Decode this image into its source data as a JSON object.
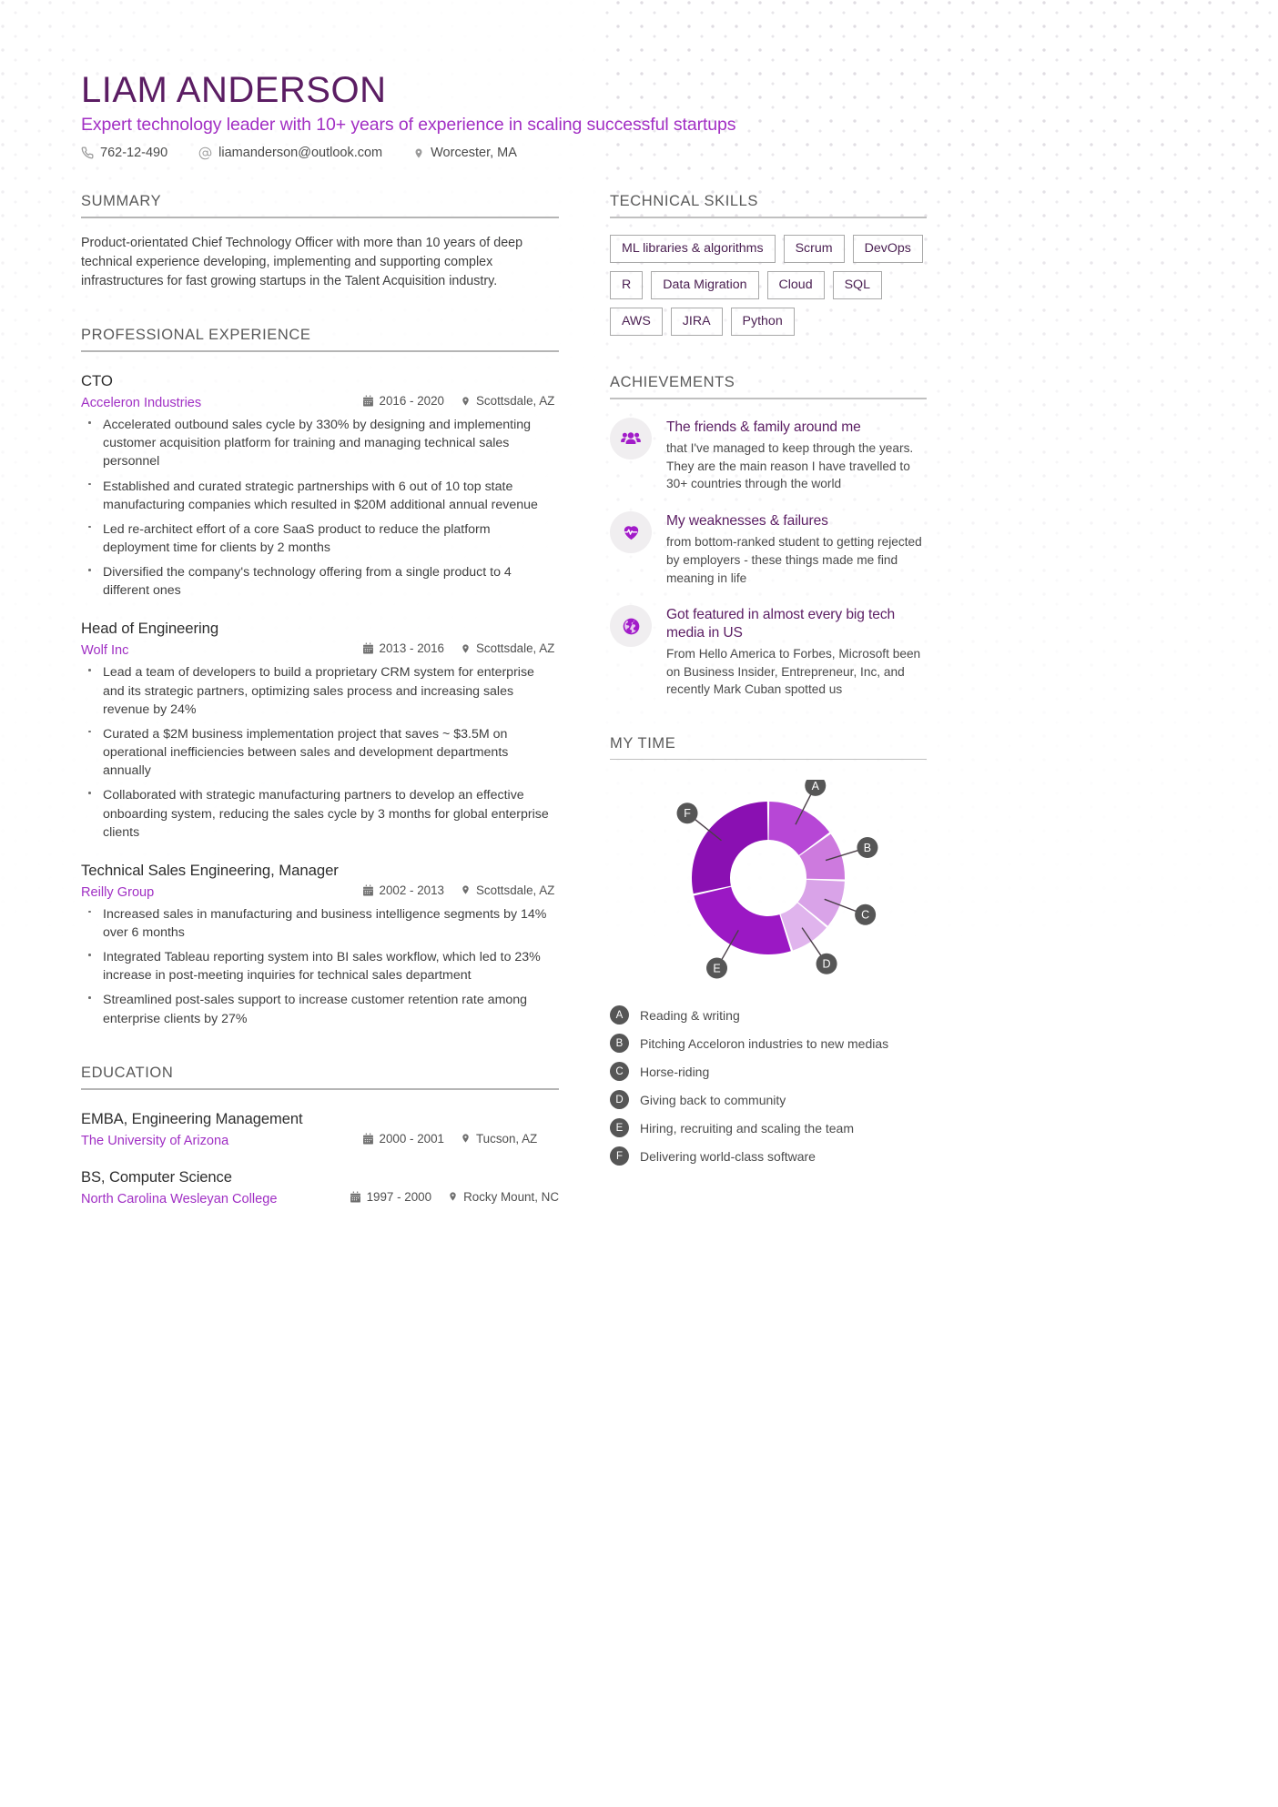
{
  "header": {
    "name": "LIAM ANDERSON",
    "tagline": "Expert technology leader with 10+ years of experience in scaling successful startups",
    "phone": "762-12-490",
    "email": "liamanderson@outlook.com",
    "location": "Worcester, MA"
  },
  "summary": {
    "title": "SUMMARY",
    "text": "Product-orientated Chief Technology Officer with more than 10 years of deep technical experience developing, implementing and supporting complex infrastructures for fast growing startups in the Talent Acquisition industry."
  },
  "experience": {
    "title": "PROFESSIONAL EXPERIENCE",
    "jobs": [
      {
        "role": "CTO",
        "company": "Acceleron Industries",
        "dates": "2016 - 2020",
        "location": "Scottsdale, AZ",
        "bullets": [
          "Accelerated outbound sales cycle by 330% by designing and implementing customer acquisition platform for training and managing technical sales personnel",
          "Established and curated strategic partnerships with 6 out of 10 top state manufacturing companies which resulted in $20M additional annual revenue",
          "Led re-architect effort of a core SaaS product to reduce the platform deployment time for clients by 2 months",
          "Diversified the company's technology offering from a single product to 4 different ones"
        ]
      },
      {
        "role": "Head of Engineering",
        "company": "Wolf Inc",
        "dates": "2013 - 2016",
        "location": "Scottsdale, AZ",
        "bullets": [
          "Lead a team of developers to build a proprietary CRM system for enterprise and its strategic partners, optimizing sales process and increasing sales revenue by 24%",
          "Curated a $2M business implementation project that saves ~ $3.5M on operational inefficiencies between sales and development departments annually",
          "Collaborated with strategic manufacturing partners to develop an effective onboarding system, reducing the sales cycle by 3 months for global enterprise clients"
        ]
      },
      {
        "role": "Technical Sales Engineering, Manager",
        "company": "Reilly Group",
        "dates": "2002 - 2013",
        "location": "Scottsdale, AZ",
        "bullets": [
          "Increased sales in manufacturing and business intelligence segments by 14% over 6 months",
          "Integrated Tableau reporting system into BI sales workflow, which led to 23% increase in post-meeting inquiries for technical sales department",
          "Streamlined post-sales support to increase customer retention rate among enterprise clients by 27%"
        ]
      }
    ]
  },
  "education": {
    "title": "EDUCATION",
    "entries": [
      {
        "degree": "EMBA, Engineering Management",
        "school": "The University of Arizona",
        "dates": "2000 - 2001",
        "location": "Tucson, AZ"
      },
      {
        "degree": "BS, Computer Science",
        "school": "North Carolina Wesleyan College",
        "dates": "1997 - 2000",
        "location": "Rocky Mount, NC"
      }
    ]
  },
  "skills": {
    "title": "TECHNICAL SKILLS",
    "tags": [
      "ML libraries & algorithms",
      "Scrum",
      "DevOps",
      "R",
      "Data Migration",
      "Cloud",
      "SQL",
      "AWS",
      "JIRA",
      "Python"
    ]
  },
  "achievements": {
    "title": "ACHIEVEMENTS",
    "items": [
      {
        "icon": "people-group-icon",
        "title": "The friends & family around me",
        "desc": "that I've managed to keep through the years. They are the main reason I have travelled to 30+ countries through the world"
      },
      {
        "icon": "heart-pulse-icon",
        "title": "My weaknesses & failures",
        "desc": "from bottom-ranked student to getting rejected by employers - these things made me find meaning in life"
      },
      {
        "icon": "globe-icon",
        "title": "Got featured in almost every big tech media in US",
        "desc": "From Hello America to Forbes, Microsoft been on Business Insider, Entrepreneur, Inc, and recently Mark Cuban spotted us"
      }
    ]
  },
  "my_time": {
    "title": "MY TIME"
  },
  "chart_data": {
    "type": "pie",
    "title": "MY TIME",
    "subtype": "donut",
    "legend_position": "below",
    "categories": [
      "A",
      "B",
      "C",
      "D",
      "E",
      "F"
    ],
    "labels": [
      "Reading & writing",
      "Pitching Acceloron industries to new medias",
      "Horse-riding",
      "Giving back to community",
      "Hiring, recruiting and scaling the team",
      "Delivering world-class software"
    ],
    "values": [
      15,
      10.5,
      10.5,
      9,
      26.5,
      28.5
    ],
    "colors": [
      "#b747d6",
      "#cd7ade",
      "#d9a3e8",
      "#e0b4ed",
      "#9b18c4",
      "#8a10b2"
    ],
    "start_angle": 0
  }
}
